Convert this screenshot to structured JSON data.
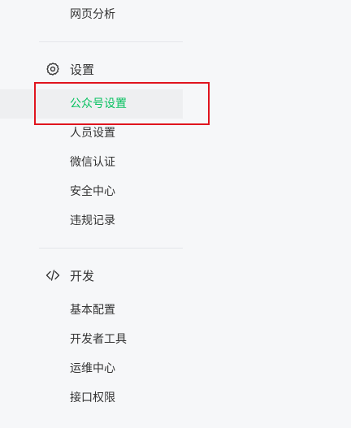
{
  "menu": {
    "top_item": "网页分析",
    "settings": {
      "title": "设置",
      "icon": "gear-icon",
      "items": [
        "公众号设置",
        "人员设置",
        "微信认证",
        "安全中心",
        "违规记录"
      ],
      "active_index": 0
    },
    "develop": {
      "title": "开发",
      "icon": "code-icon",
      "items": [
        "基本配置",
        "开发者工具",
        "运维中心",
        "接口权限"
      ]
    }
  },
  "colors": {
    "active_text": "#07c160",
    "highlight_border": "#e0141e"
  }
}
